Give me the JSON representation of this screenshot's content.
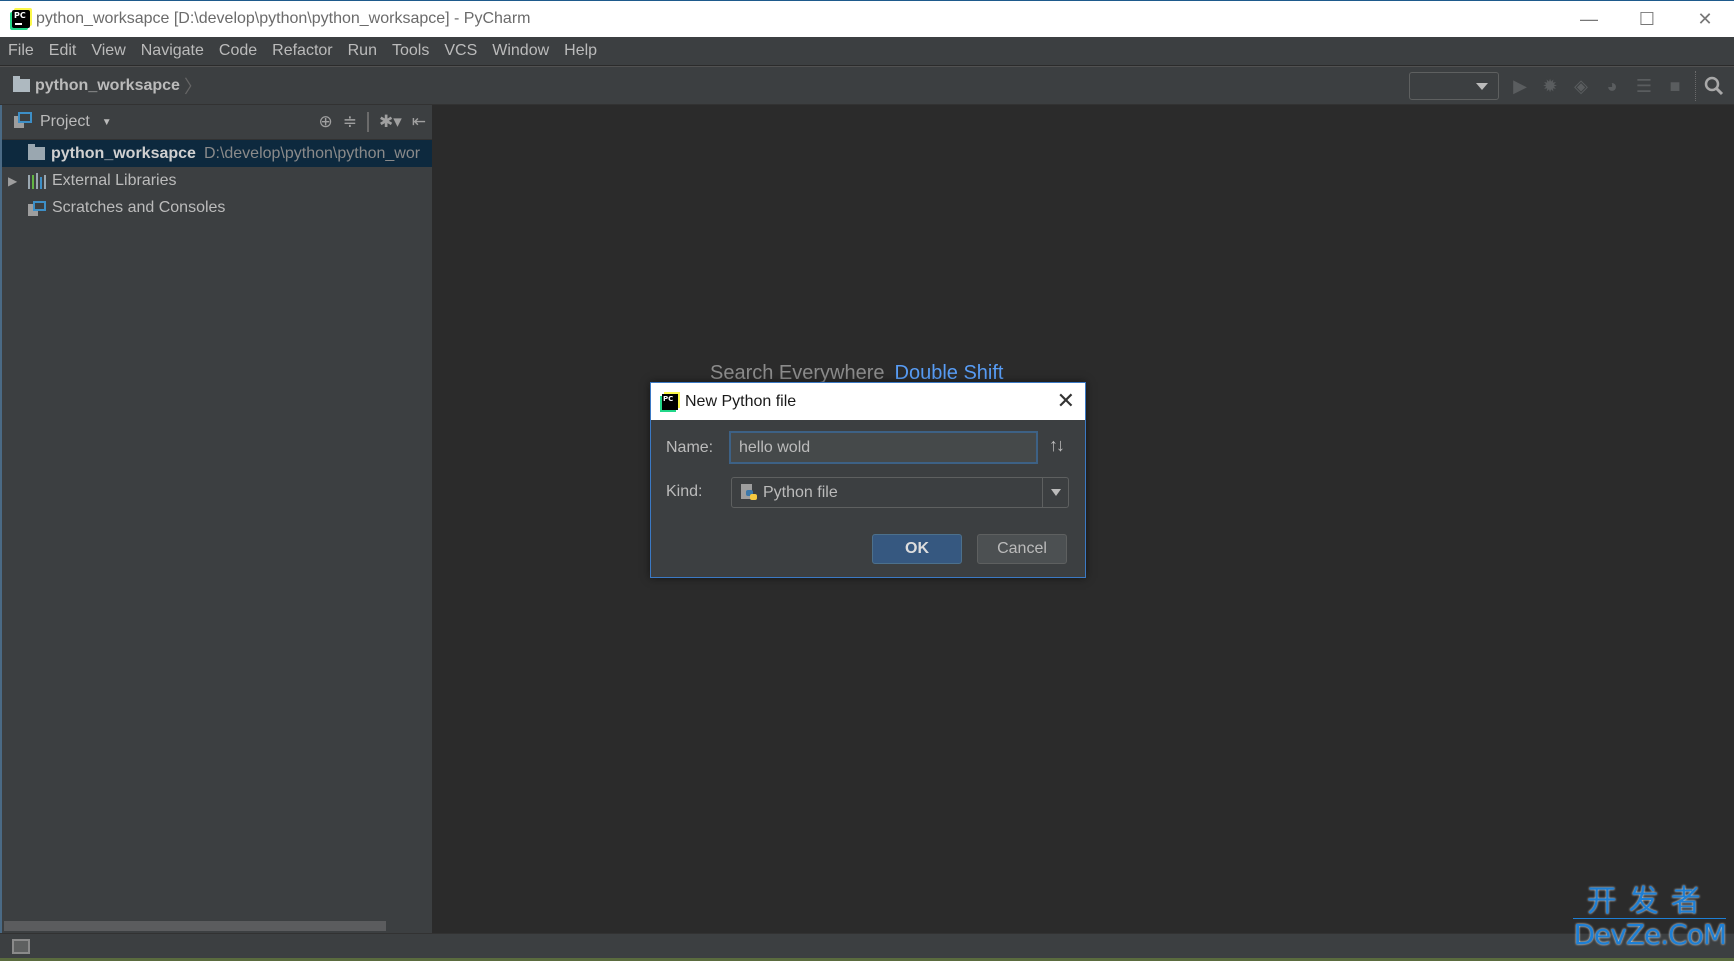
{
  "window": {
    "title": "python_worksapce [D:\\develop\\python\\python_worksapce] - PyCharm",
    "controls": {
      "minimize": "—",
      "maximize": "☐",
      "close": "✕"
    }
  },
  "menu": [
    {
      "label": "File"
    },
    {
      "label": "Edit"
    },
    {
      "label": "View"
    },
    {
      "label": "Navigate"
    },
    {
      "label": "Code"
    },
    {
      "label": "Refactor"
    },
    {
      "label": "Run"
    },
    {
      "label": "Tools"
    },
    {
      "label": "VCS"
    },
    {
      "label": "Window"
    },
    {
      "label": "Help"
    }
  ],
  "navbar": {
    "breadcrumb": "python_worksapce",
    "run_config_value": "",
    "icons": [
      "run-icon",
      "debug-icon",
      "coverage-icon",
      "profile-icon",
      "concurrency-icon",
      "stop-icon",
      "search-icon"
    ]
  },
  "project_panel": {
    "title": "Project",
    "tree": [
      {
        "label": "python_worksapce",
        "path": "D:\\develop\\python\\python_wor",
        "selected": true
      },
      {
        "label": "External Libraries",
        "collapsed": true
      },
      {
        "label": "Scratches and Consoles"
      }
    ]
  },
  "editor": {
    "hint_action": "Search Everywhere",
    "hint_shortcut": "Double Shift"
  },
  "dialog": {
    "title": "New Python file",
    "name_label": "Name:",
    "name_value": "hello wold",
    "kind_label": "Kind:",
    "kind_value": "Python file",
    "ok_label": "OK",
    "cancel_label": "Cancel"
  },
  "watermark": {
    "cn": "开发者",
    "en": "DevZe.CoM"
  },
  "colors": {
    "accent": "#3b79c4",
    "hint_key": "#589df6",
    "selection": "#0d293e",
    "ok_button": "#365880"
  }
}
